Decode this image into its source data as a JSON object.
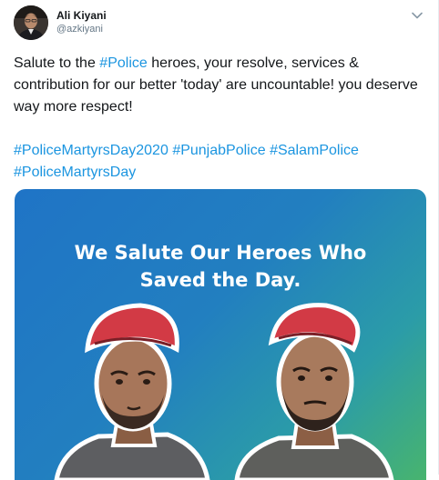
{
  "user": {
    "display_name": "Ali Kiyani",
    "handle": "@azkiyani"
  },
  "tweet": {
    "text_before": "Salute to the ",
    "hashtag_inline": "#Police",
    "text_after": " heroes, your resolve, services & contribution for our better 'today' are uncountable! you deserve way more respect!",
    "hashtags": [
      "#PoliceMartyrsDay2020",
      "#PunjabPolice",
      "#SalamPolice",
      "#PoliceMartyrsDay"
    ]
  },
  "image": {
    "headline_line1": "We Salute Our Heroes Who",
    "headline_line2": "Saved the Day."
  },
  "colors": {
    "link": "#1b95e0",
    "beret": "#d23a45",
    "media_gradient": [
      "#1f74c6",
      "#48b46e"
    ]
  },
  "icons": {
    "menu": "chevron-down-icon"
  }
}
